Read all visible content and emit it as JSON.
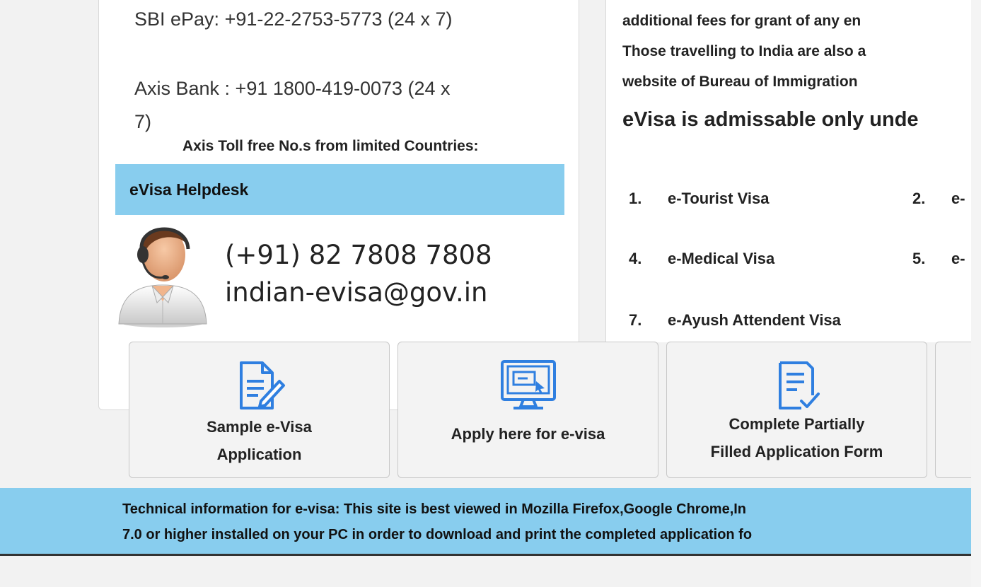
{
  "colors": {
    "helpdesk_bar": "#88cdee",
    "icon_blue": "#2f7fe0",
    "tile_bg": "#f3f3f3"
  },
  "contact": {
    "sbi_epay": "SBI ePay: +91-22-2753-5773 (24 x 7)",
    "axis_line1": "Axis Bank : +91 1800-419-0073 (24 x",
    "axis_line2": "7)",
    "axis_toll_free": "Axis Toll free No.s from limited Countries:"
  },
  "helpdesk": {
    "title": "eVisa Helpdesk",
    "phone": "(+91) 82 7808 7808",
    "email": "indian-evisa@gov.in",
    "image_icon": "support-agent-headset"
  },
  "info": {
    "fees_line": "additional fees for grant of any en",
    "travel_line": "Those travelling to India are also a",
    "bureau_line": "website of Bureau of Immigration",
    "admissable": "eVisa is admissable only unde"
  },
  "visa_list": [
    {
      "num": "1.",
      "label": "e-Tourist Visa"
    },
    {
      "num": "2.",
      "label": "e-"
    },
    {
      "num": "4.",
      "label": "e-Medical Visa"
    },
    {
      "num": "5.",
      "label": "e-"
    },
    {
      "num": "7.",
      "label": "e-Ayush Attendent Visa"
    }
  ],
  "tiles": [
    {
      "icon": "document-edit-icon",
      "line1": "Sample e-Visa",
      "line2": "Application"
    },
    {
      "icon": "computer-form-icon",
      "line1": "Apply here for e-visa",
      "line2": ""
    },
    {
      "icon": "checklist-icon",
      "line1": "Complete Partially",
      "line2": "Filled Application Form"
    }
  ],
  "tech": {
    "label": "Technical information for e-visa:",
    "line1_rest": " This site is best viewed in Mozilla Firefox,Google Chrome,In",
    "line2": "7.0 or higher installed on your PC in order to download and print the completed application fo"
  }
}
